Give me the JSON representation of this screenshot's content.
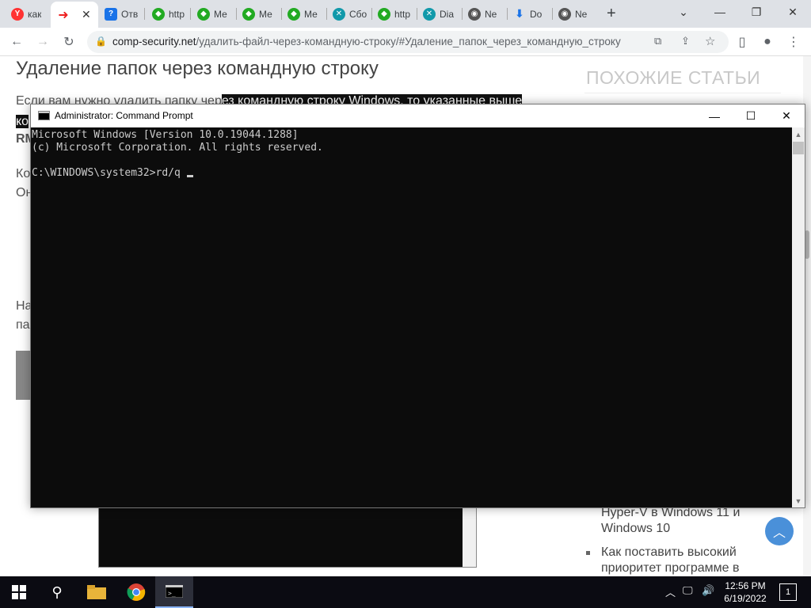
{
  "browser": {
    "tabs": [
      {
        "icon": "yandex-icon",
        "title": "как",
        "color": "#f33"
      },
      {
        "icon": "red-arrow-icon",
        "title": "",
        "active": true
      },
      {
        "icon": "question-icon",
        "title": "Отв",
        "color": "#1a73e8"
      },
      {
        "icon": "green-shield-icon",
        "title": "http",
        "color": "#2a2"
      },
      {
        "icon": "green-shield-icon",
        "title": "Ме",
        "color": "#2a2"
      },
      {
        "icon": "green-shield-icon",
        "title": "Ме",
        "color": "#2a2"
      },
      {
        "icon": "green-shield-icon",
        "title": "Ме",
        "color": "#2a2"
      },
      {
        "icon": "teal-x-icon",
        "title": "Сбо",
        "color": "#19a"
      },
      {
        "icon": "green-shield-icon",
        "title": "http",
        "color": "#2a2"
      },
      {
        "icon": "teal-x-icon",
        "title": "Dia",
        "color": "#19a"
      },
      {
        "icon": "chrome-icon",
        "title": "Ne",
        "color": "#555"
      },
      {
        "icon": "download-icon",
        "title": "Do",
        "color": "#1a73e8"
      },
      {
        "icon": "chrome-icon",
        "title": "Ne",
        "color": "#555"
      }
    ],
    "new_tab_label": "+",
    "url_host": "comp-security.net",
    "url_path": "/удалить-файл-через-командную-строку/#Удаление_папок_через_командную_строку"
  },
  "page": {
    "title": "Удаление папок через командную строку",
    "para1_start": "Если вам нужно удалить папку чер",
    "para1_hl": "ез командную строку Windows, то указанные выше",
    "para2_hl": "ко",
    "para3": "RM",
    "para4": "Ко",
    "para5": "Он",
    "para6": "На",
    "para7": "па",
    "sidebar_title": "ПОХОЖИЕ СТАТЬИ",
    "related": [
      {
        "line1": "Hyper-V в Windows 11 и",
        "line2": "Windows 10",
        "bullet": false
      },
      {
        "line1": "Как поставить высокий",
        "line2": "приоритет программе в",
        "bullet": true
      }
    ]
  },
  "cmd": {
    "title": "Administrator: Command Prompt",
    "lines": [
      "Microsoft Windows [Version 10.0.19044.1288]",
      "(c) Microsoft Corporation. All rights reserved.",
      "",
      "C:\\WINDOWS\\system32>rd/q"
    ]
  },
  "taskbar": {
    "time": "12:56 PM",
    "date": "6/19/2022",
    "notifications": "1"
  }
}
